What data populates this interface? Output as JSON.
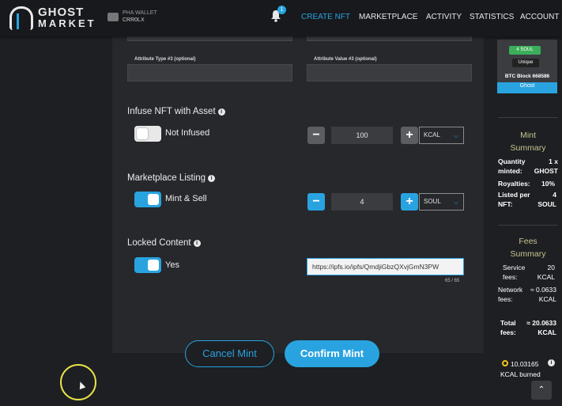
{
  "header": {
    "logo_line1": "GHOST",
    "logo_line2": "MARKET",
    "wallet_label": "PHA WALLET",
    "wallet_address": "CRR0LX",
    "notification_count": "1",
    "nav": [
      "CREATE NFT",
      "MARKETPLACE",
      "ACTIVITY",
      "STATISTICS",
      "ACCOUNT"
    ],
    "active_nav": "CREATE NFT"
  },
  "form": {
    "attr_type_label": "Attribute Type #3 (optional)",
    "attr_value_label": "Attribute Value #3 (optional)",
    "infuse": {
      "label": "Infuse NFT with Asset",
      "toggle_label": "Not Infused",
      "toggle_on": false,
      "amount": "100",
      "token": "KCAL"
    },
    "listing": {
      "label": "Marketplace Listing",
      "toggle_label": "Mint & Sell",
      "toggle_on": true,
      "amount": "4",
      "token": "SOUL"
    },
    "locked": {
      "label": "Locked Content",
      "toggle_label": "Yes",
      "toggle_on": true,
      "url": "https://ipfs.io/ipfs/QmdjiGbzQXvjGmN3PW",
      "counter": "65 / 65"
    },
    "cancel_label": "Cancel Mint",
    "confirm_label": "Confirm Mint"
  },
  "sidebar": {
    "card": {
      "price": "4 SOUL",
      "badge": "Unique",
      "title": "BTC Block 668586",
      "collection": "Ghost"
    },
    "mint_summary": {
      "title1": "Mint",
      "title2": "Summary",
      "quantity_label": "Quantity minted:",
      "quantity_value": "1 x GHOST",
      "royalties_label": "Royalties:",
      "royalties_value": "10%",
      "listed_label": "Listed per NFT:",
      "listed_value": "4 SOUL"
    },
    "fees_summary": {
      "title1": "Fees",
      "title2": "Summary",
      "service_label": "Service fees:",
      "service_value": "20 KCAL",
      "network_label": "Network fees:",
      "network_value": "≈ 0.0633 KCAL",
      "total_label": "Total fees:",
      "total_value": "≈ 20.0633 KCAL",
      "burn_value": "10.03165",
      "burn_label": "KCAL burned"
    }
  },
  "colors": {
    "accent": "#29a3e0",
    "background": "#1d1f22",
    "panel": "#26282c",
    "summary_heading": "#c7c490"
  }
}
